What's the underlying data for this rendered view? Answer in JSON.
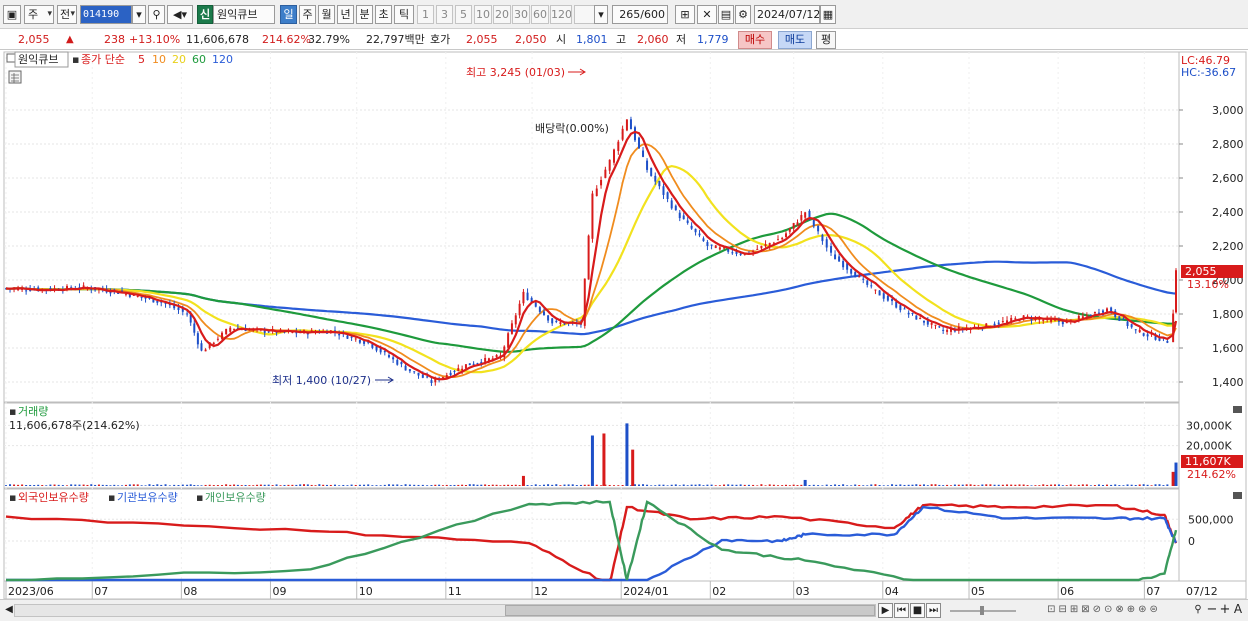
{
  "toolbar": {
    "market": "주",
    "prev": "전",
    "code": "014190",
    "stock_badge": "신",
    "stock_name": "원익큐브",
    "periods": [
      "일",
      "주",
      "월",
      "년",
      "분",
      "초",
      "틱"
    ],
    "active_period": "일",
    "intervals": [
      "1",
      "3",
      "5",
      "10",
      "20",
      "30",
      "60",
      "120"
    ],
    "count": "265",
    "count_total": "/600",
    "date": "2024/07/12"
  },
  "quote": {
    "price": "2,055",
    "change": "238",
    "change_rate": "+13.10%",
    "volume": "11,606,678",
    "volume_ratio": "214.62%",
    "turnover": "32.79%",
    "amount": "22,797백만",
    "ask_label": "호가",
    "ask": "2,055",
    "bid": "2,050",
    "open_label": "시",
    "open": "1,801",
    "high_label": "고",
    "high": "2,060",
    "low_label": "저",
    "low": "1,779",
    "buy_label": "매수",
    "sell_label": "매도",
    "eval_label": "평"
  },
  "chart": {
    "legend_stock": "원익큐브",
    "legend_ma_title": "종가 단순",
    "ma_periods": [
      "5",
      "10",
      "20",
      "60",
      "120"
    ],
    "ma_colors": [
      "#d81b1b",
      "#f08c1e",
      "#f2e21e",
      "#1e9a3c",
      "#2a5cd8"
    ],
    "lc": "LC:46.79",
    "hc": "HC:-36.67",
    "high_note": "최고 3,245 (01/03)",
    "low_note": "최저 1,400 (10/27)",
    "dividend_note": "배당락(0.00%)",
    "last_price_tag": "2,055",
    "last_pct_tag": "13.10%",
    "volume_title": "거래량",
    "volume_value": "11,606,678주(214.62%)",
    "volume_tag": "11,607K",
    "volume_pct_tag": "214.62%",
    "holdings_titles": [
      "외국인보유수량",
      "기관보유수량",
      "개인보유수량"
    ],
    "holdings_colors": [
      "#d81b1b",
      "#2a5cd8",
      "#3a9a5c"
    ],
    "x_labels": [
      "2023/06",
      "07",
      "08",
      "09",
      "10",
      "11",
      "12",
      "2024/01",
      "02",
      "03",
      "04",
      "05",
      "06",
      "07"
    ],
    "x_last_label": "07/12",
    "up_color": "#d81b1b",
    "down_color": "#1d4fc8"
  },
  "chart_data": {
    "type": "candlestick",
    "price_axis": {
      "ticks": [
        1400,
        1600,
        1800,
        2000,
        2200,
        2400,
        2600,
        2800,
        3000
      ],
      "tick_labels": [
        "1,400",
        "1,600",
        "1,800",
        "2,000",
        "2,200",
        "2,400",
        "2,600",
        "2,800",
        "3,000"
      ]
    },
    "volume_axis": {
      "ticks": [
        20000,
        30000
      ],
      "tick_labels": [
        "20,000K",
        "30,000K"
      ]
    },
    "holdings_axis": {
      "ticks": [
        0,
        500000
      ],
      "tick_labels": [
        "0",
        "500,000"
      ]
    },
    "close_series": [
      {
        "date": "2023/06/01",
        "close": 1950
      },
      {
        "date": "2023/06/15",
        "close": 1945
      },
      {
        "date": "2023/06/28",
        "close": 1955
      },
      {
        "date": "2023/07/10",
        "close": 1930
      },
      {
        "date": "2023/07/25",
        "close": 1870
      },
      {
        "date": "2023/08/03",
        "close": 1800
      },
      {
        "date": "2023/08/08",
        "close": 1580
      },
      {
        "date": "2023/08/18",
        "close": 1720
      },
      {
        "date": "2023/08/30",
        "close": 1700
      },
      {
        "date": "2023/09/10",
        "close": 1690
      },
      {
        "date": "2023/09/22",
        "close": 1700
      },
      {
        "date": "2023/10/05",
        "close": 1630
      },
      {
        "date": "2023/10/18",
        "close": 1480
      },
      {
        "date": "2023/10/27",
        "close": 1400
      },
      {
        "date": "2023/11/08",
        "close": 1500
      },
      {
        "date": "2023/11/20",
        "close": 1550
      },
      {
        "date": "2023/11/28",
        "close": 1920
      },
      {
        "date": "2023/12/08",
        "close": 1750
      },
      {
        "date": "2023/12/18",
        "close": 1740
      },
      {
        "date": "2023/12/22",
        "close": 2500
      },
      {
        "date": "2023/12/28",
        "close": 2700
      },
      {
        "date": "2024/01/03",
        "close": 2950
      },
      {
        "date": "2024/01/10",
        "close": 2650
      },
      {
        "date": "2024/01/20",
        "close": 2400
      },
      {
        "date": "2024/01/31",
        "close": 2200
      },
      {
        "date": "2024/02/13",
        "close": 2150
      },
      {
        "date": "2024/02/26",
        "close": 2250
      },
      {
        "date": "2024/03/05",
        "close": 2400
      },
      {
        "date": "2024/03/14",
        "close": 2150
      },
      {
        "date": "2024/03/28",
        "close": 1950
      },
      {
        "date": "2024/04/10",
        "close": 1800
      },
      {
        "date": "2024/04/22",
        "close": 1700
      },
      {
        "date": "2024/05/07",
        "close": 1730
      },
      {
        "date": "2024/05/20",
        "close": 1780
      },
      {
        "date": "2024/06/04",
        "close": 1750
      },
      {
        "date": "2024/06/18",
        "close": 1830
      },
      {
        "date": "2024/06/28",
        "close": 1700
      },
      {
        "date": "2024/07/09",
        "close": 1640
      },
      {
        "date": "2024/07/11",
        "close": 1817
      },
      {
        "date": "2024/07/12",
        "close": 2055
      }
    ],
    "volume_series": [
      {
        "date": "2023/11/28",
        "volume": 5000
      },
      {
        "date": "2023/12/22",
        "volume": 25000
      },
      {
        "date": "2023/12/26",
        "volume": 26000
      },
      {
        "date": "2024/01/03",
        "volume": 31000
      },
      {
        "date": "2024/01/05",
        "volume": 18000
      },
      {
        "date": "2024/03/05",
        "volume": 3000
      },
      {
        "date": "2024/07/11",
        "volume": 7000
      },
      {
        "date": "2024/07/12",
        "volume": 11607
      }
    ],
    "holdings_series": [
      {
        "name": "외국인보유수량",
        "values": [
          {
            "date": "2023/06/01",
            "value": 560000
          },
          {
            "date": "2023/09/15",
            "value": 230000
          },
          {
            "date": "2023/11/30",
            "value": -50000
          },
          {
            "date": "2023/12/28",
            "value": -1000000
          },
          {
            "date": "2024/01/03",
            "value": 780000
          },
          {
            "date": "2024/01/25",
            "value": 500000
          },
          {
            "date": "2024/02/26",
            "value": 560000
          },
          {
            "date": "2024/04/05",
            "value": 300000
          },
          {
            "date": "2024/04/15",
            "value": 820000
          },
          {
            "date": "2024/05/15",
            "value": 780000
          },
          {
            "date": "2024/06/20",
            "value": 820000
          },
          {
            "date": "2024/07/08",
            "value": 600000
          },
          {
            "date": "2024/07/12",
            "value": -50000
          }
        ]
      },
      {
        "name": "기관보유수량",
        "values": [
          {
            "date": "2023/06/01",
            "value": -1000000
          },
          {
            "date": "2023/11/20",
            "value": -1000000
          },
          {
            "date": "2023/12/28",
            "value": -1000000
          },
          {
            "date": "2024/01/10",
            "value": -900000
          },
          {
            "date": "2024/02/05",
            "value": 20000
          },
          {
            "date": "2024/02/26",
            "value": 0
          },
          {
            "date": "2024/03/05",
            "value": 150000
          },
          {
            "date": "2024/04/05",
            "value": 150000
          },
          {
            "date": "2024/04/15",
            "value": 780000
          },
          {
            "date": "2024/05/15",
            "value": 520000
          },
          {
            "date": "2024/06/20",
            "value": 520000
          },
          {
            "date": "2024/07/08",
            "value": 520000
          },
          {
            "date": "2024/07/12",
            "value": -40000
          }
        ]
      },
      {
        "name": "개인보유수량",
        "values": [
          {
            "date": "2023/06/01",
            "value": -900000
          },
          {
            "date": "2023/09/15",
            "value": -650000
          },
          {
            "date": "2023/11/30",
            "value": 850000
          },
          {
            "date": "2023/12/28",
            "value": 900000
          },
          {
            "date": "2024/01/03",
            "value": -900000
          },
          {
            "date": "2024/01/10",
            "value": 900000
          },
          {
            "date": "2024/02/05",
            "value": -200000
          },
          {
            "date": "2024/03/05",
            "value": -450000
          },
          {
            "date": "2024/04/15",
            "value": -950000
          },
          {
            "date": "2024/05/15",
            "value": -1000000
          },
          {
            "date": "2024/06/20",
            "value": -1050000
          },
          {
            "date": "2024/07/08",
            "value": -750000
          },
          {
            "date": "2024/07/12",
            "value": 250000
          }
        ]
      }
    ]
  },
  "bottom": {
    "nav_buttons": [
      "▶",
      "⏮",
      "■",
      "⏭"
    ],
    "zoom_minus": "−",
    "zoom_plus": "+",
    "font_a": "A"
  }
}
